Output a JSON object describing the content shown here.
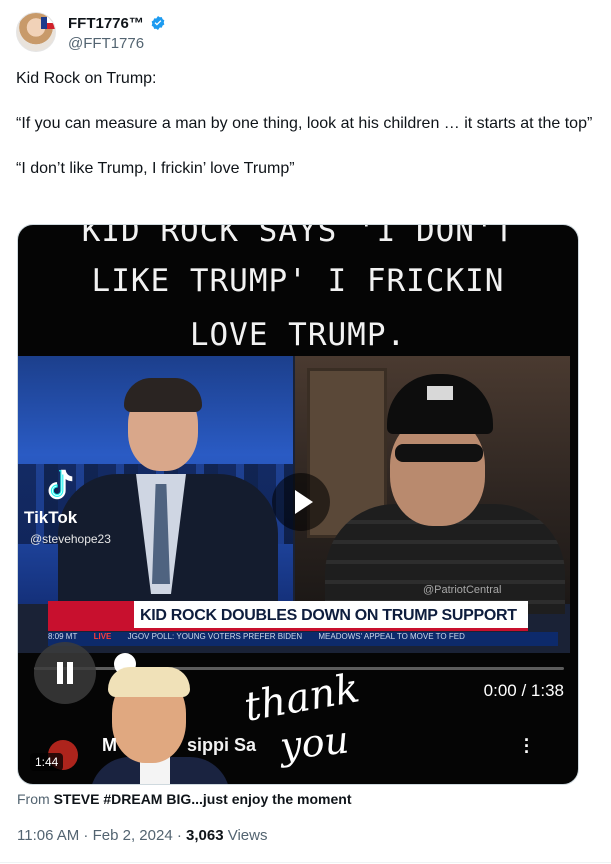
{
  "author": {
    "display_name": "FFT1776™",
    "handle": "@FFT1776",
    "verified": true,
    "verified_color": "#1d9bf0"
  },
  "tweet": {
    "paragraphs": [
      "Kid Rock on Trump:",
      "“If you can measure a man by one thing, look at his children … it starts at the top”",
      "“I don’t like Trump, I frickin’ love Trump”"
    ]
  },
  "video": {
    "caption_line1": "KID ROCK SAYS 'I DON'T",
    "caption_line2": "LIKE TRUMP' I FRICKIN",
    "caption_line3": "LOVE TRUMP.",
    "tiktok_brand": "TikTok",
    "tiktok_user": "@stevehope23",
    "watermark": "@PatriotCentral",
    "news_headline": "KID ROCK DOUBLES DOWN ON TRUMP SUPPORT",
    "ticker_time": "8:09 MT",
    "ticker_live": "LIVE",
    "ticker_item1": "JGOV POLL: YOUNG VOTERS PREFER BIDEN",
    "ticker_item2": "MEADOWS' APPEAL TO MOVE TO FED",
    "overlay_prefix": "M",
    "overlay_suffix": "sippi Sa",
    "script_thank": "thank",
    "script_you": "you",
    "time_current": "0:00",
    "time_total": "1:38",
    "time_readout": "0:00 / 1:38",
    "duration_badge": "1:44",
    "progress_fraction": 0.0,
    "more_icon": "more-vertical-icon",
    "play_icon": "play-icon",
    "pause_icon": "pause-icon",
    "accent_color": "#1d9bf0"
  },
  "source": {
    "prefix": "From ",
    "name": "STEVE #DREAM BIG...just enjoy the moment"
  },
  "meta": {
    "time": "11:06 AM",
    "separator": " · ",
    "date": "Feb 2, 2024",
    "views_count": "3,063",
    "views_label": "Views"
  }
}
